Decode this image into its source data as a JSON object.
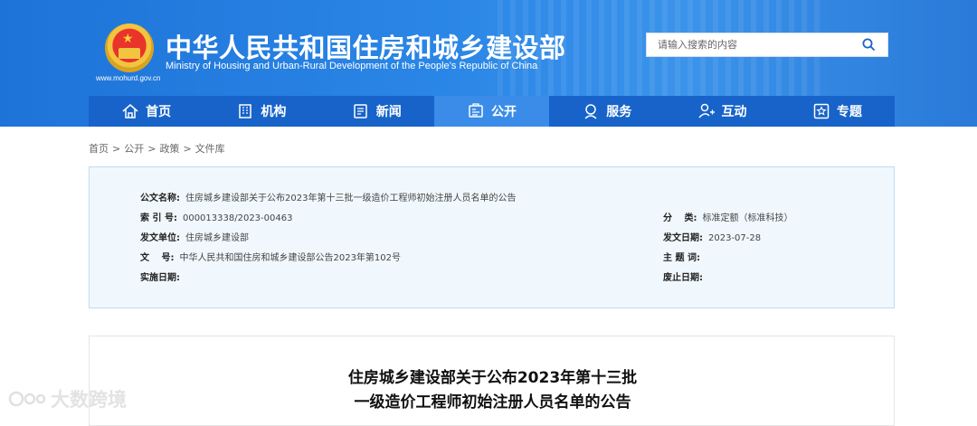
{
  "header": {
    "site_title": "中华人民共和国住房和城乡建设部",
    "site_title_en": "Ministry of Housing and Urban-Rural Development of the People’s Republic of China",
    "site_url": "www.mohurd.gov.cn",
    "emblem_icon": "national-emblem-icon",
    "search": {
      "placeholder": "请输入搜索的内容",
      "icon": "search-icon"
    }
  },
  "nav": {
    "items": [
      {
        "label": "首页",
        "icon": "home-icon"
      },
      {
        "label": "机构",
        "icon": "building-icon"
      },
      {
        "label": "新闻",
        "icon": "news-icon"
      },
      {
        "label": "公开",
        "icon": "disclosure-icon",
        "active": true
      },
      {
        "label": "服务",
        "icon": "service-icon"
      },
      {
        "label": "互动",
        "icon": "interaction-icon"
      },
      {
        "label": "专题",
        "icon": "star-icon"
      }
    ]
  },
  "breadcrumb": [
    "首页",
    "公开",
    "政策",
    "文件库"
  ],
  "breadcrumb_separator": ">",
  "info": {
    "doc_name": {
      "label": "公文名称:",
      "value": "住房城乡建设部关于公布2023年第十三批一级造价工程师初始注册人员名单的公告"
    },
    "index_no": {
      "label": "索 引 号:",
      "value": "000013338/2023-00463"
    },
    "category": {
      "label": "分　 类:",
      "value": "标准定额（标准科技）"
    },
    "issuer": {
      "label": "发文单位:",
      "value": "住房城乡建设部"
    },
    "issue_date": {
      "label": "发文日期:",
      "value": "2023-07-28"
    },
    "doc_no": {
      "label": "文　 号:",
      "value": "中华人民共和国住房和城乡建设部公告2023年第102号"
    },
    "subject": {
      "label": "主 题 词:",
      "value": ""
    },
    "effective_date": {
      "label": "实施日期:",
      "value": ""
    },
    "repeal_date": {
      "label": "废止日期:",
      "value": ""
    }
  },
  "article": {
    "title_line1": "住房城乡建设部关于公布2023年第十三批",
    "title_line2": "一级造价工程师初始注册人员名单的公告"
  },
  "watermark": {
    "text": "大数跨境",
    "icon": "watermark-logo-icon"
  },
  "colors": {
    "header_blue": "#2a86e6",
    "nav_blue": "#1763c9",
    "nav_active": "#3a8ce8",
    "info_bg": "#f1f8fd",
    "info_border": "#bfdcf1"
  }
}
